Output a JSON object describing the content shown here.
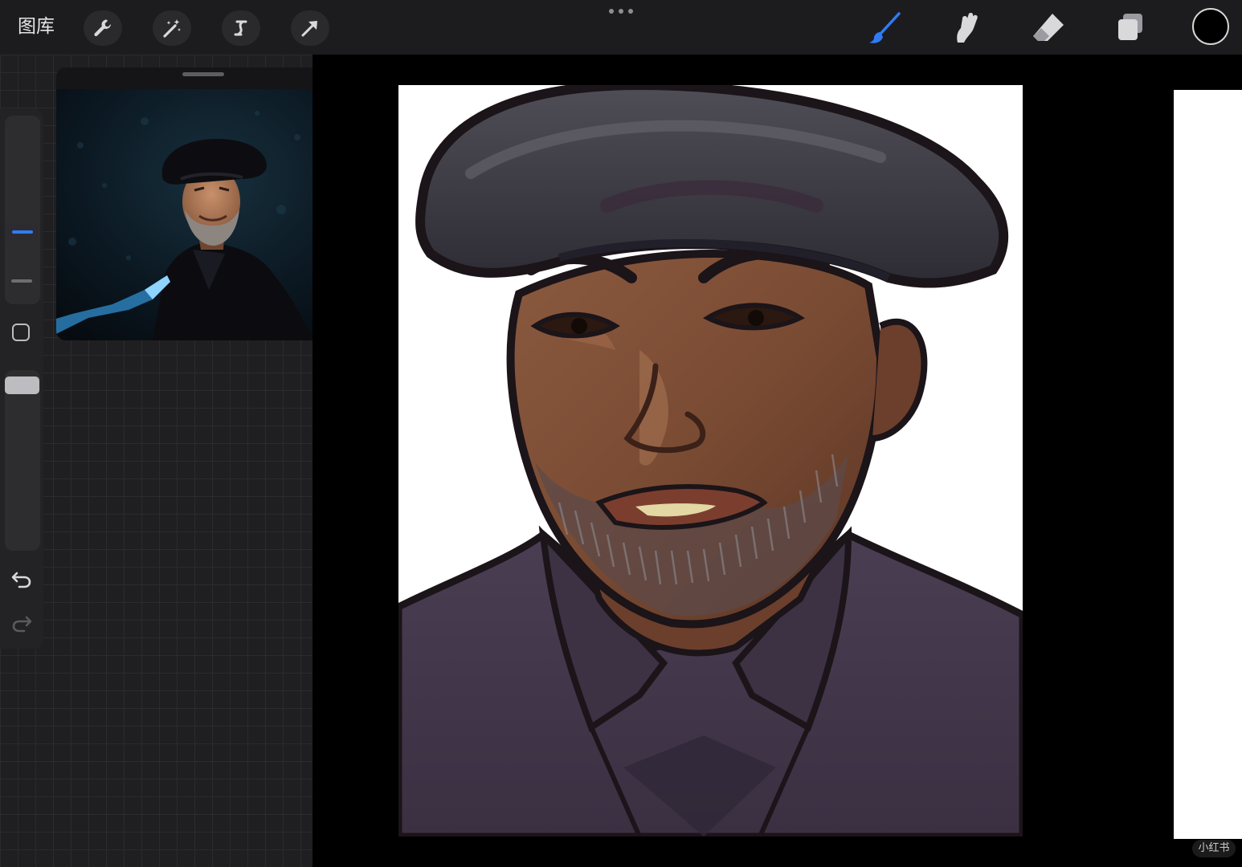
{
  "toolbar": {
    "gallery_label": "图库",
    "left_tools": [
      "wrench-icon",
      "magic-wand-icon",
      "selection-icon",
      "transform-arrow-icon"
    ],
    "more_menu": "more-dots-icon",
    "right_tools": [
      "brush-icon",
      "smudge-icon",
      "eraser-icon",
      "layers-icon"
    ],
    "active_tool": "brush",
    "active_color": "#000000",
    "accent_color": "#2f7bf6"
  },
  "sidebar": {
    "controls": [
      "brush-size-slider",
      "modify-button",
      "opacity-slider",
      "undo-icon",
      "redo-icon"
    ]
  },
  "reference": {
    "panel": "reference-photo"
  },
  "canvas": {
    "artwork": "digital-portrait-painting",
    "watermark": "小红书"
  }
}
